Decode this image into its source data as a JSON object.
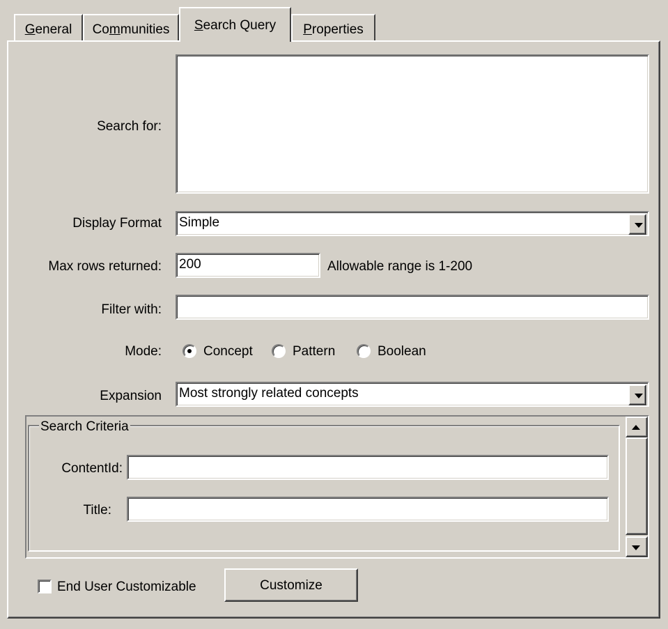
{
  "tabs": [
    {
      "label": "General",
      "mnemonic": "G",
      "active": false
    },
    {
      "label": "Communities",
      "mnemonic": "m",
      "active": false
    },
    {
      "label": "Search Query",
      "mnemonic": "S",
      "active": true
    },
    {
      "label": "Properties",
      "mnemonic": "P",
      "active": false
    }
  ],
  "form": {
    "search_for_label": "Search for:",
    "search_for_value": "",
    "display_format_label": "Display Format",
    "display_format_value": "Simple",
    "max_rows_label": "Max rows returned:",
    "max_rows_value": "200",
    "max_rows_hint": "Allowable range is 1-200",
    "filter_label": "Filter with:",
    "filter_value": "",
    "mode_label": "Mode:",
    "mode_options": [
      "Concept",
      "Pattern",
      "Boolean"
    ],
    "mode_selected": "Concept",
    "expansion_label": "Expansion",
    "expansion_value": "Most strongly related concepts"
  },
  "criteria": {
    "group_title": "Search Criteria",
    "content_id_label": "ContentId:",
    "content_id_value": "",
    "title_label": "Title:",
    "title_value": ""
  },
  "footer": {
    "customizable_label": "End User Customizable",
    "customizable_checked": false,
    "customize_button": "Customize"
  },
  "icons": {
    "dropdown": "chevron-down-icon",
    "scroll_up": "arrow-up-icon",
    "scroll_down": "arrow-down-icon"
  }
}
